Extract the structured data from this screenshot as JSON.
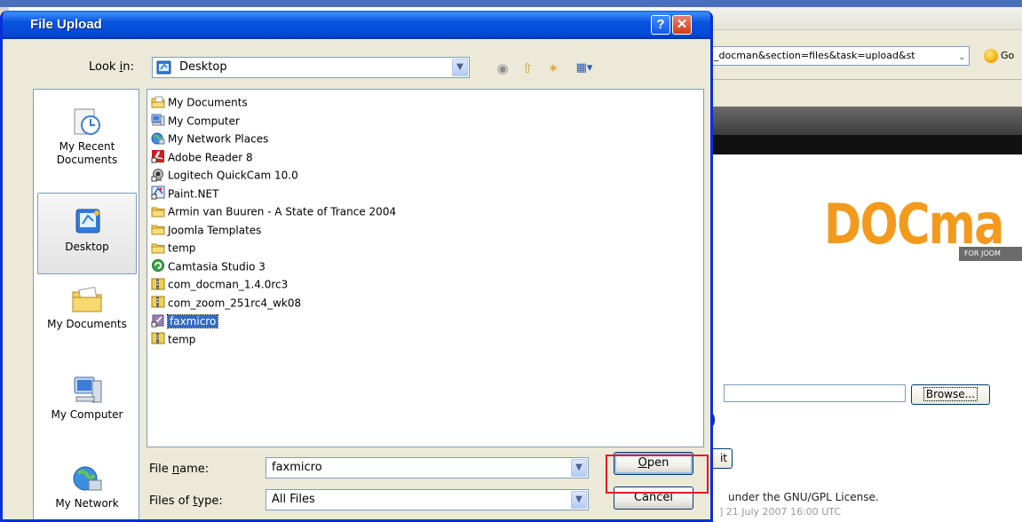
{
  "browser": {
    "url_text": "_docman&section=files&task=upload&st",
    "go_label": "Go",
    "logo_text": "DOCma",
    "logo_sub": "FOR JOOM",
    "browse_label": "Browse...",
    "submit_fragment": "it",
    "license_text": "under the GNU/GPL License.",
    "date_text": "] 21 July 2007 16:00 UTC"
  },
  "dialog": {
    "title": "File Upload",
    "help_glyph": "?",
    "close_glyph": "✕",
    "look_in": {
      "label_pre": "Look ",
      "label_accel": "i",
      "label_post": "n:",
      "value": "Desktop"
    },
    "places": [
      {
        "label": "My Recent Documents",
        "icon": "recent-documents-icon",
        "selected": false
      },
      {
        "label": "Desktop",
        "icon": "desktop-icon",
        "selected": true
      },
      {
        "label": "My Documents",
        "icon": "my-documents-icon",
        "selected": false
      },
      {
        "label": "My Computer",
        "icon": "my-computer-icon",
        "selected": false
      },
      {
        "label": "My Network",
        "icon": "my-network-icon",
        "selected": false
      }
    ],
    "files": [
      {
        "name": "My Documents",
        "icon": "my-documents-icon"
      },
      {
        "name": "My Computer",
        "icon": "my-computer-icon"
      },
      {
        "name": "My Network Places",
        "icon": "network-places-icon"
      },
      {
        "name": "Adobe Reader 8",
        "icon": "adobe-reader-icon"
      },
      {
        "name": "Logitech QuickCam 10.0",
        "icon": "webcam-icon"
      },
      {
        "name": "Paint.NET",
        "icon": "paintnet-icon"
      },
      {
        "name": "Armin van Buuren - A State of Trance 2004",
        "icon": "folder-icon"
      },
      {
        "name": "Joomla Templates",
        "icon": "folder-icon"
      },
      {
        "name": "temp",
        "icon": "folder-icon"
      },
      {
        "name": "Camtasia Studio 3",
        "icon": "camtasia-icon"
      },
      {
        "name": "com_docman_1.4.0rc3",
        "icon": "zip-icon"
      },
      {
        "name": "com_zoom_251rc4_wk08",
        "icon": "zip-icon"
      },
      {
        "name": "faxmicro",
        "icon": "shortcut-icon"
      },
      {
        "name": "temp",
        "icon": "zip-icon"
      }
    ],
    "selected_file": "faxmicro",
    "file_name": {
      "label_pre": "File ",
      "label_accel": "n",
      "label_post": "ame:",
      "value": "faxmicro"
    },
    "file_type": {
      "label_pre": "Files of ",
      "label_accel": "t",
      "label_post": "ype:",
      "value": "All Files"
    },
    "open_button": {
      "accel": "O",
      "rest": "pen"
    },
    "cancel_button": "Cancel",
    "colors": {
      "titlebar": "#0855dd",
      "selection": "#316ac5",
      "highlight_box": "#e51a22",
      "logo": "#f39a1c"
    }
  }
}
